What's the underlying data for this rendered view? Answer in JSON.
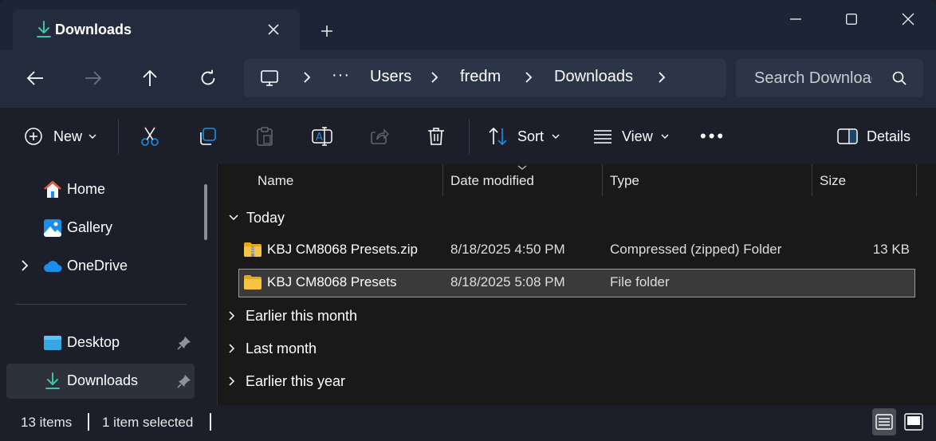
{
  "colors": {
    "titlebar_bg": "#1c2536",
    "tab_bg": "#232c3d",
    "accent_download": "#3fc2a3",
    "folder_yellow": "#f6c342",
    "onedrive_blue": "#1a8ee8"
  },
  "tab": {
    "title": "Downloads",
    "icon": "download-icon"
  },
  "window_controls": [
    "minimize",
    "maximize",
    "close"
  ],
  "address": {
    "breadcrumb": [
      "Users",
      "fredm",
      "Downloads"
    ],
    "overflow": "···",
    "search_placeholder": "Search Downloads"
  },
  "toolbar": {
    "new_label": "New",
    "sort_label": "Sort",
    "view_label": "View",
    "more_label": "•••",
    "details_label": "Details"
  },
  "sidebar": {
    "home": "Home",
    "gallery": "Gallery",
    "onedrive": "OneDrive",
    "desktop": "Desktop",
    "downloads": "Downloads"
  },
  "columns": {
    "name": "Name",
    "date": "Date modified",
    "type": "Type",
    "size": "Size"
  },
  "groups": {
    "today": "Today",
    "earlier_month": "Earlier this month",
    "last_month": "Last month",
    "earlier_year": "Earlier this year"
  },
  "files": [
    {
      "name": "KBJ CM8068 Presets.zip",
      "date": "8/18/2025 4:50 PM",
      "type": "Compressed (zipped) Folder",
      "size": "13 KB",
      "icon": "zip-folder-icon"
    },
    {
      "name": "KBJ CM8068 Presets",
      "date": "8/18/2025 5:08 PM",
      "type": "File folder",
      "size": "",
      "icon": "folder-icon"
    }
  ],
  "status": {
    "items": "13 items",
    "selected": "1 item selected"
  }
}
